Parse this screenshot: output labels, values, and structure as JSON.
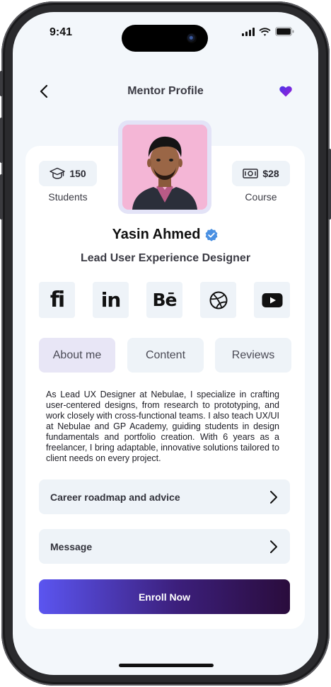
{
  "status_bar": {
    "time": "9:41"
  },
  "header": {
    "title": "Mentor Profile",
    "back_icon": "chevron-left-icon",
    "favorite_icon": "heart-icon"
  },
  "stats": {
    "students": {
      "value": "150",
      "caption": "Students",
      "icon": "graduation-cap-icon"
    },
    "course": {
      "value": "$28",
      "caption": "Course",
      "icon": "banknote-icon"
    }
  },
  "profile": {
    "name": "Yasin Ahmed",
    "verified_icon": "verified-badge-icon",
    "role": "Lead User Experience Designer"
  },
  "social": [
    {
      "name": "fiverr",
      "glyph": "fi"
    },
    {
      "name": "linkedin",
      "glyph": "in"
    },
    {
      "name": "behance",
      "glyph": "Bē"
    },
    {
      "name": "dribbble",
      "glyph": ""
    },
    {
      "name": "youtube",
      "glyph": ""
    }
  ],
  "tabs": [
    {
      "label": "About me",
      "active": true
    },
    {
      "label": "Content",
      "active": false
    },
    {
      "label": "Reviews",
      "active": false
    }
  ],
  "about_text": "As Lead UX Designer at Nebulae, I specialize in crafting user-centered designs, from research to prototyping, and work closely with cross-functional teams. I also teach UX/UI at Nebulae and GP Academy, guiding students in design fundamentals and portfolio creation. With 6 years as a freelancer, I bring adaptable, innovative solutions tailored to client needs on every project.",
  "actions": {
    "roadmap_label": "Career roadmap and advice",
    "message_label": "Message",
    "enroll_label": "Enroll Now"
  },
  "colors": {
    "accent_start": "#5b55f0",
    "accent_end": "#2a0c3c",
    "verified": "#4a90e2",
    "heart": "#6a2be0"
  }
}
